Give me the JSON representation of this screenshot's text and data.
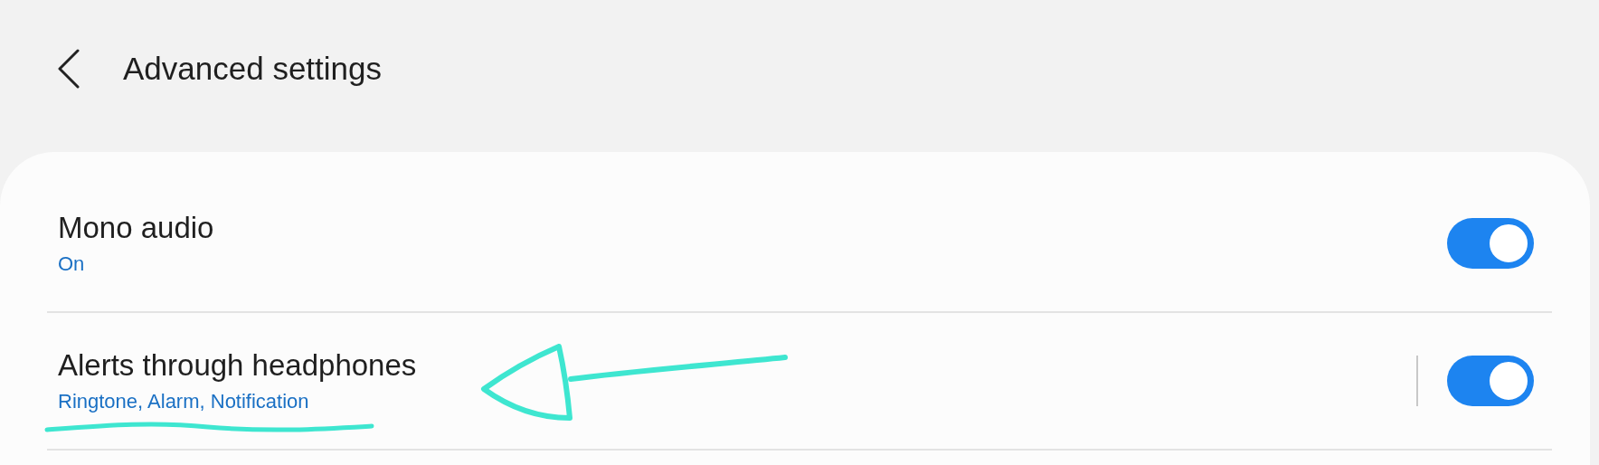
{
  "header": {
    "title": "Advanced settings"
  },
  "settings": [
    {
      "title": "Mono audio",
      "summary": "On",
      "on": true,
      "separator": false
    },
    {
      "title": "Alerts through headphones",
      "summary": "Ringtone, Alarm, Notification",
      "on": true,
      "separator": true
    }
  ]
}
